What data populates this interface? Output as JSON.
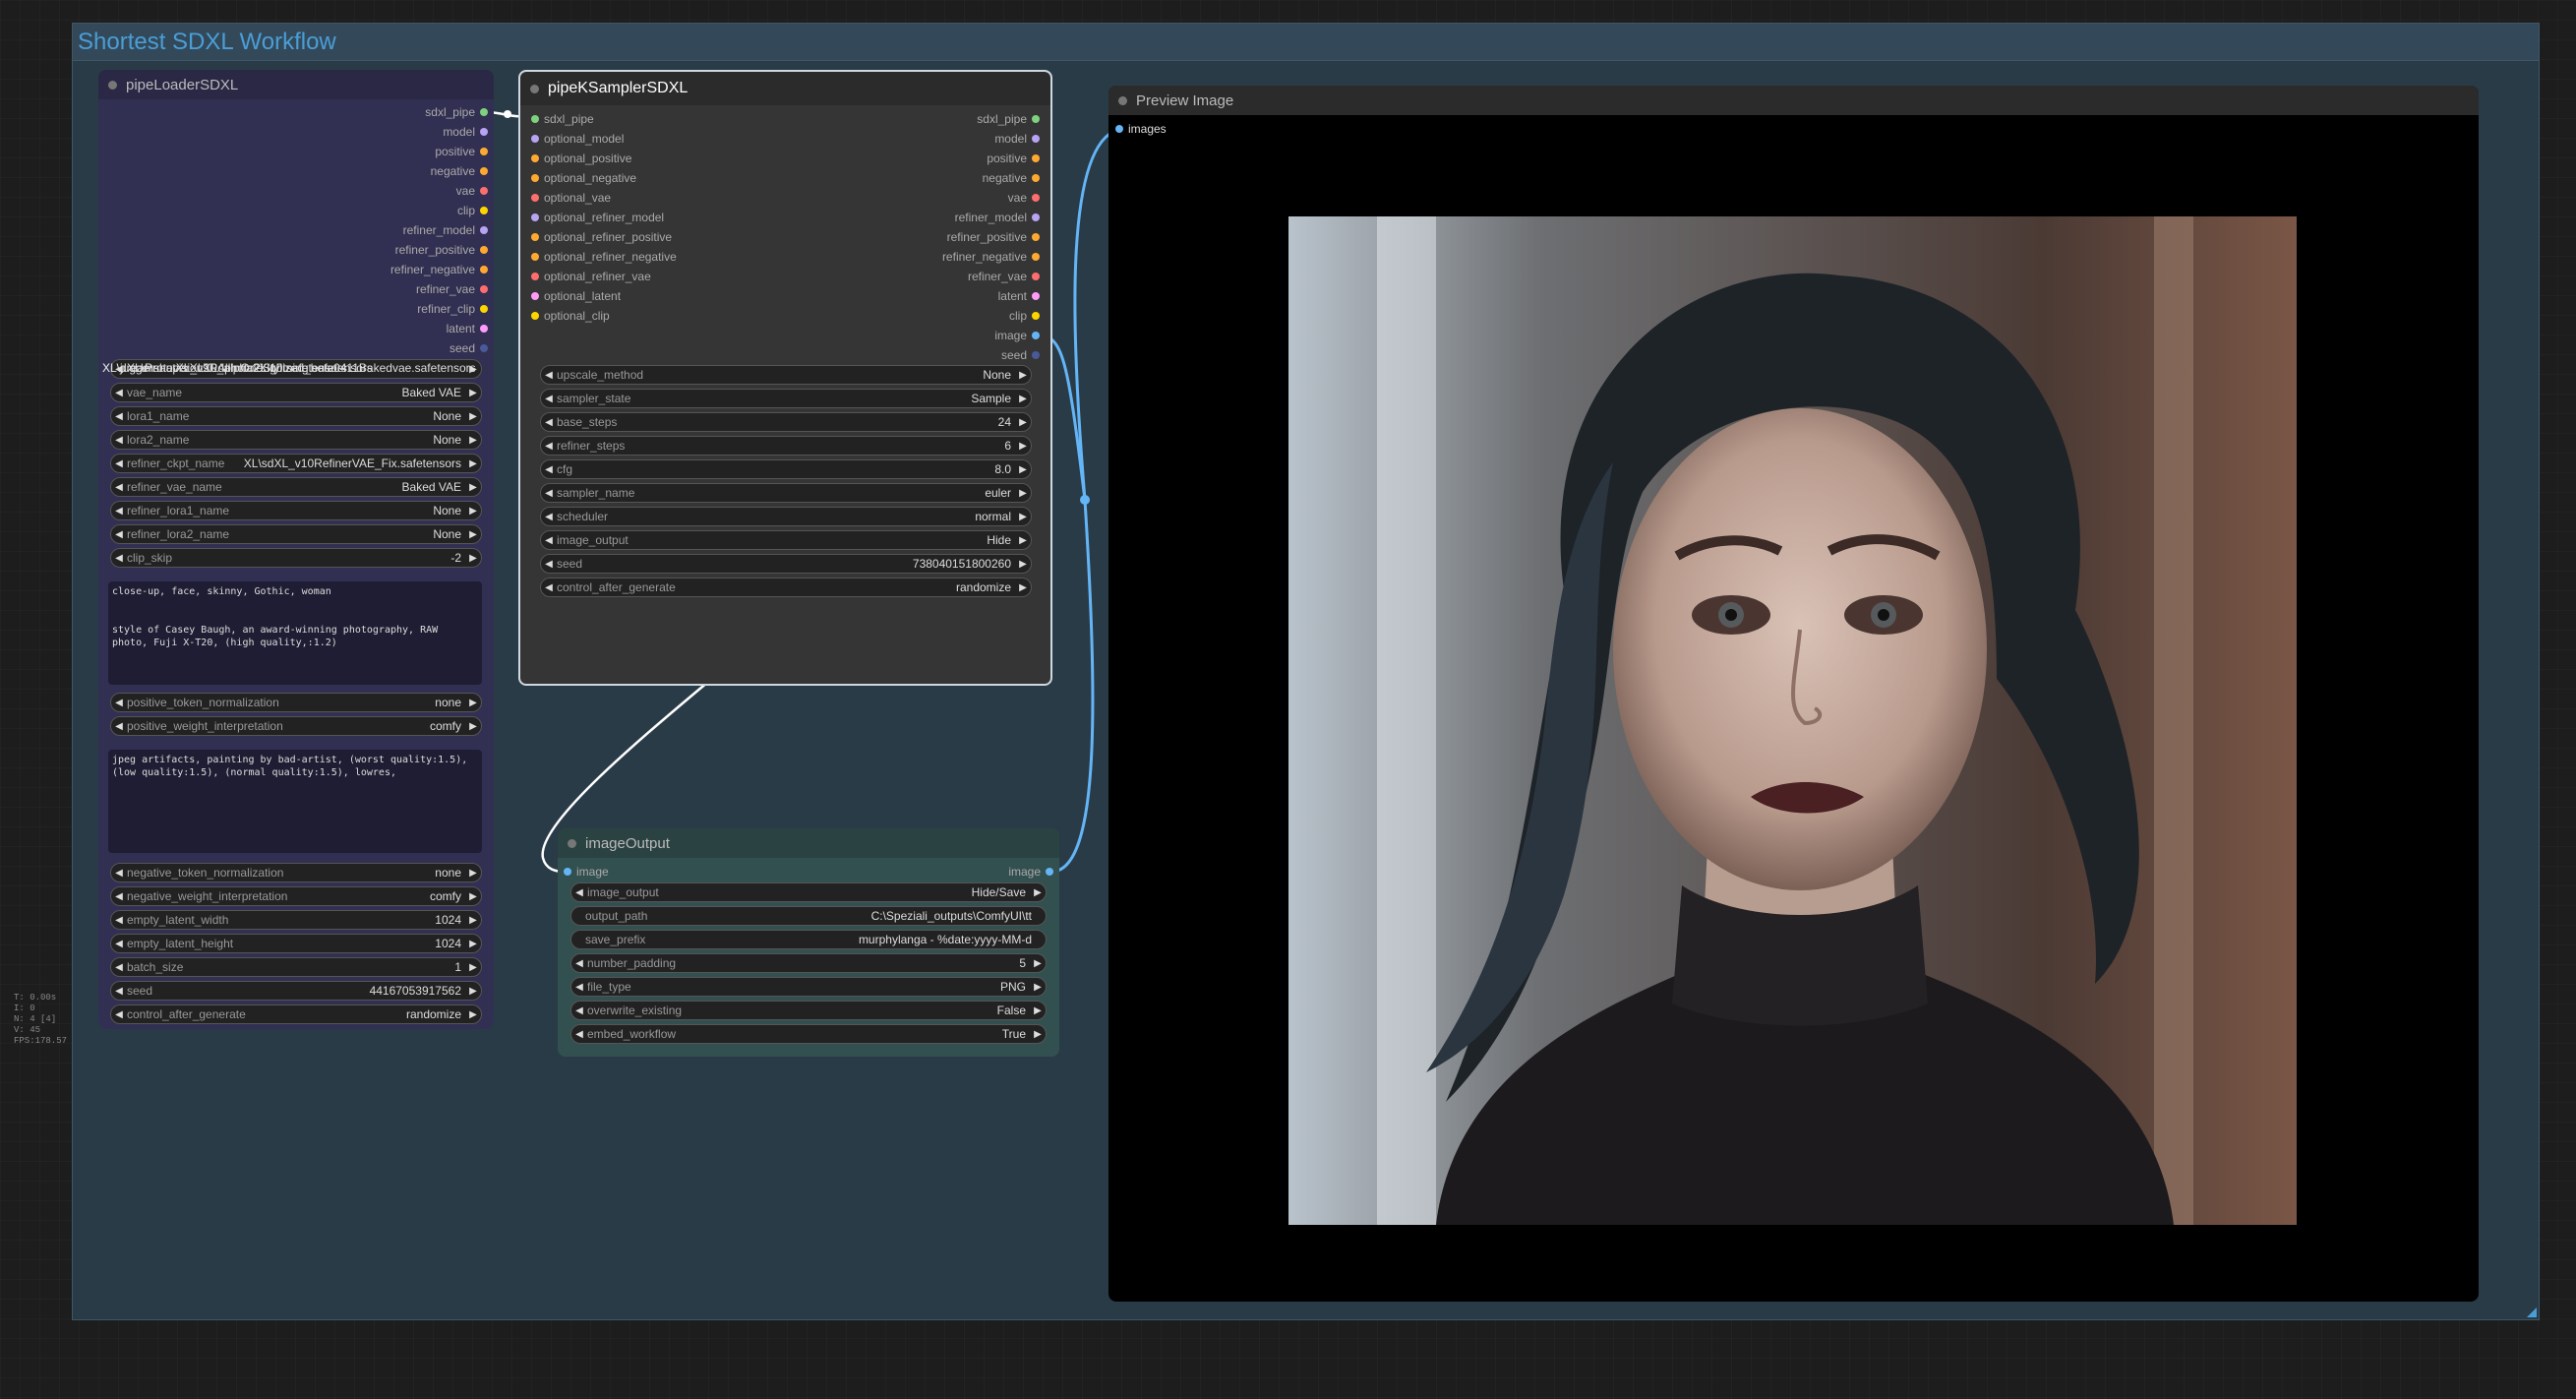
{
  "group": {
    "title": "Shortest SDXL Workflow"
  },
  "loader": {
    "title": "pipeLoaderSDXL",
    "outputs": [
      {
        "label": "sdxl_pipe",
        "color": "#7fd17f"
      },
      {
        "label": "model",
        "color": "#b8a4f2"
      },
      {
        "label": "positive",
        "color": "#ffa931"
      },
      {
        "label": "negative",
        "color": "#ffa931"
      },
      {
        "label": "vae",
        "color": "#ff6e6e"
      },
      {
        "label": "clip",
        "color": "#ffd500"
      },
      {
        "label": "refiner_model",
        "color": "#b8a4f2"
      },
      {
        "label": "refiner_positive",
        "color": "#ffa931"
      },
      {
        "label": "refiner_negative",
        "color": "#ffa931"
      },
      {
        "label": "refiner_vae",
        "color": "#ff6e6e"
      },
      {
        "label": "refiner_clip",
        "color": "#ffd500"
      },
      {
        "label": "latent",
        "color": "#ff9cf9"
      },
      {
        "label": "seed",
        "color": "#4a5a99"
      }
    ],
    "ckpt_name": "XL\\dreamshaperXL10_alpha2Xl10.safetensors",
    "ckpt_overlay": "XL\\juggernautXL_v9Rdphoto2Lightning.safetensors",
    "ckpt_label": "XL\\ProtovisionXLAllInOneStylized_beta0411Bakedvae.safetensors",
    "widgets_a": [
      {
        "label": "vae_name",
        "value": "Baked VAE"
      },
      {
        "label": "lora1_name",
        "value": "None"
      },
      {
        "label": "lora2_name",
        "value": "None"
      },
      {
        "label": "refiner_ckpt_name",
        "value": "XL\\sdXL_v10RefinerVAE_Fix.safetensors"
      },
      {
        "label": "refiner_vae_name",
        "value": "Baked VAE"
      },
      {
        "label": "refiner_lora1_name",
        "value": "None"
      },
      {
        "label": "refiner_lora2_name",
        "value": "None"
      },
      {
        "label": "clip_skip",
        "value": "-2"
      }
    ],
    "positive_text": "close-up, face, skinny, Gothic, woman\n\n\nstyle of Casey Baugh, an award-winning photography, RAW photo, Fuji X-T20, (high quality,:1.2)",
    "widgets_b": [
      {
        "label": "positive_token_normalization",
        "value": "none"
      },
      {
        "label": "positive_weight_interpretation",
        "value": "comfy"
      }
    ],
    "negative_text": "jpeg artifacts, painting by bad-artist, (worst quality:1.5), (low quality:1.5), (normal quality:1.5), lowres,",
    "widgets_c": [
      {
        "label": "negative_token_normalization",
        "value": "none"
      },
      {
        "label": "negative_weight_interpretation",
        "value": "comfy"
      },
      {
        "label": "empty_latent_width",
        "value": "1024"
      },
      {
        "label": "empty_latent_height",
        "value": "1024"
      },
      {
        "label": "batch_size",
        "value": "1"
      },
      {
        "label": "seed",
        "value": "441670539175​62"
      },
      {
        "label": "control_after_generate",
        "value": "randomize"
      }
    ]
  },
  "sampler": {
    "title": "pipeKSamplerSDXL",
    "inputs": [
      {
        "label": "sdxl_pipe",
        "color": "#7fd17f"
      },
      {
        "label": "optional_model",
        "color": "#b8a4f2"
      },
      {
        "label": "optional_positive",
        "color": "#ffa931"
      },
      {
        "label": "optional_negative",
        "color": "#ffa931"
      },
      {
        "label": "optional_vae",
        "color": "#ff6e6e"
      },
      {
        "label": "optional_refiner_model",
        "color": "#b8a4f2"
      },
      {
        "label": "optional_refiner_positive",
        "color": "#ffa931"
      },
      {
        "label": "optional_refiner_negative",
        "color": "#ffa931"
      },
      {
        "label": "optional_refiner_vae",
        "color": "#ff6e6e"
      },
      {
        "label": "optional_latent",
        "color": "#ff9cf9"
      },
      {
        "label": "optional_clip",
        "color": "#ffd500"
      }
    ],
    "outputs": [
      {
        "label": "sdxl_pipe",
        "color": "#7fd17f"
      },
      {
        "label": "model",
        "color": "#b8a4f2"
      },
      {
        "label": "positive",
        "color": "#ffa931"
      },
      {
        "label": "negative",
        "color": "#ffa931"
      },
      {
        "label": "vae",
        "color": "#ff6e6e"
      },
      {
        "label": "refiner_model",
        "color": "#b8a4f2"
      },
      {
        "label": "refiner_positive",
        "color": "#ffa931"
      },
      {
        "label": "refiner_negative",
        "color": "#ffa931"
      },
      {
        "label": "refiner_vae",
        "color": "#ff6e6e"
      },
      {
        "label": "latent",
        "color": "#ff9cf9"
      },
      {
        "label": "clip",
        "color": "#ffd500"
      },
      {
        "label": "image",
        "color": "#64b5f6"
      },
      {
        "label": "seed",
        "color": "#4a5a99"
      }
    ],
    "widgets": [
      {
        "label": "upscale_method",
        "value": "None"
      },
      {
        "label": "sampler_state",
        "value": "Sample"
      },
      {
        "label": "base_steps",
        "value": "24"
      },
      {
        "label": "refiner_steps",
        "value": "6"
      },
      {
        "label": "cfg",
        "value": "8.0"
      },
      {
        "label": "sampler_name",
        "value": "euler"
      },
      {
        "label": "scheduler",
        "value": "normal"
      },
      {
        "label": "image_output",
        "value": "Hide"
      },
      {
        "label": "seed",
        "value": "738040151800260"
      },
      {
        "label": "control_after_generate",
        "value": "randomize"
      }
    ]
  },
  "imgout": {
    "title": "imageOutput",
    "input": {
      "label": "image",
      "color": "#64b5f6"
    },
    "output": {
      "label": "image",
      "color": "#64b5f6"
    },
    "widgets": [
      {
        "label": "image_output",
        "value": "Hide/Save",
        "kind": "combo"
      },
      {
        "label": "output_path",
        "value": "C:\\Speziali_outputs\\ComfyUI\\tt",
        "kind": "text"
      },
      {
        "label": "save_prefix",
        "value": "murphylanga - %date:yyyy-MM-d",
        "kind": "text"
      },
      {
        "label": "number_padding",
        "value": "5",
        "kind": "combo"
      },
      {
        "label": "file_type",
        "value": "PNG",
        "kind": "combo"
      },
      {
        "label": "overwrite_existing",
        "value": "False",
        "kind": "combo"
      },
      {
        "label": "embed_workflow",
        "value": "True",
        "kind": "combo"
      }
    ]
  },
  "preview": {
    "title": "Preview Image",
    "input": {
      "label": "images",
      "color": "#64b5f6"
    }
  },
  "stats": [
    "T: 0.00s",
    "I: 0",
    "N: 4 [4]",
    "V: 45",
    "FPS:178.57"
  ],
  "colors": {
    "link_image": "#64b5f6",
    "link_pipe": "#ffffff"
  }
}
